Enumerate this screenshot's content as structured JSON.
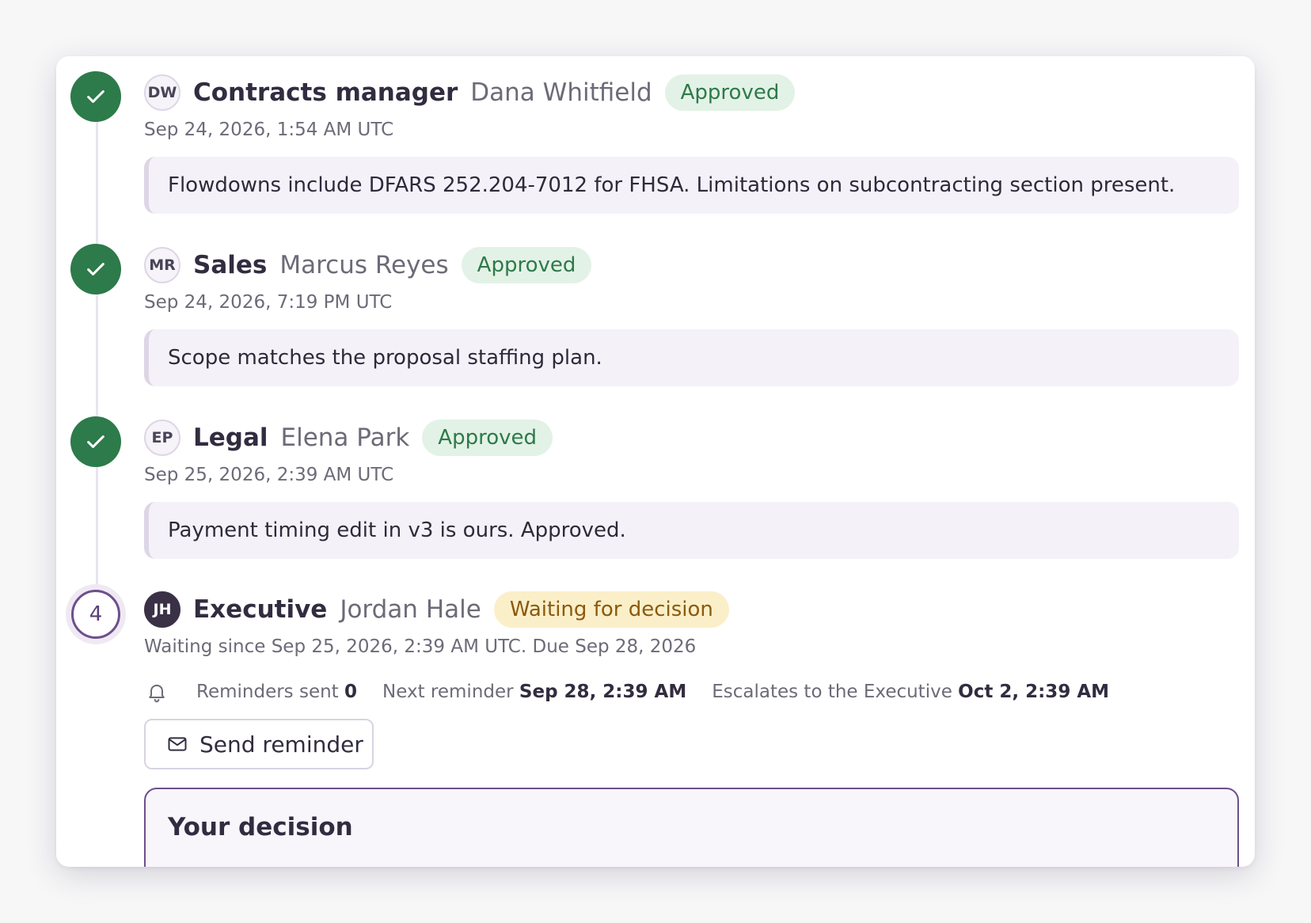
{
  "steps": [
    {
      "initials": "DW",
      "role": "Contracts manager",
      "person": "Dana Whitfield",
      "status": "Approved",
      "timestamp": "Sep 24, 2026, 1:54 AM UTC",
      "comment": "Flowdowns include DFARS 252.204-7012 for FHSA. Limitations on subcontracting section present."
    },
    {
      "initials": "MR",
      "role": "Sales",
      "person": "Marcus Reyes",
      "status": "Approved",
      "timestamp": "Sep 24, 2026, 7:19 PM UTC",
      "comment": "Scope matches the proposal staffing plan."
    },
    {
      "initials": "EP",
      "role": "Legal",
      "person": "Elena Park",
      "status": "Approved",
      "timestamp": "Sep 25, 2026, 2:39 AM UTC",
      "comment": "Payment timing edit in v3 is ours. Approved."
    }
  ],
  "current": {
    "number": "4",
    "initials": "JH",
    "role": "Executive",
    "person": "Jordan Hale",
    "status": "Waiting for decision",
    "waiting_text": "Waiting since Sep 25, 2026, 2:39 AM UTC. Due Sep 28, 2026",
    "reminders_label": "Reminders sent",
    "reminders_count": "0",
    "next_label": "Next reminder",
    "next_value": "Sep 28, 2:39 AM",
    "escalates_label": "Escalates to the Executive",
    "escalates_value": "Oct 2, 2:39 AM",
    "send_button": "Send reminder"
  },
  "decision": {
    "title": "Your decision"
  },
  "colors": {
    "approved": "#2d7a4a",
    "approved_bg": "#e3f2e6",
    "waiting": "#8a5a0f",
    "waiting_bg": "#fbefc9",
    "accent": "#6e4f8c"
  },
  "icons": [
    "check-icon",
    "bell-icon",
    "mail-icon"
  ]
}
